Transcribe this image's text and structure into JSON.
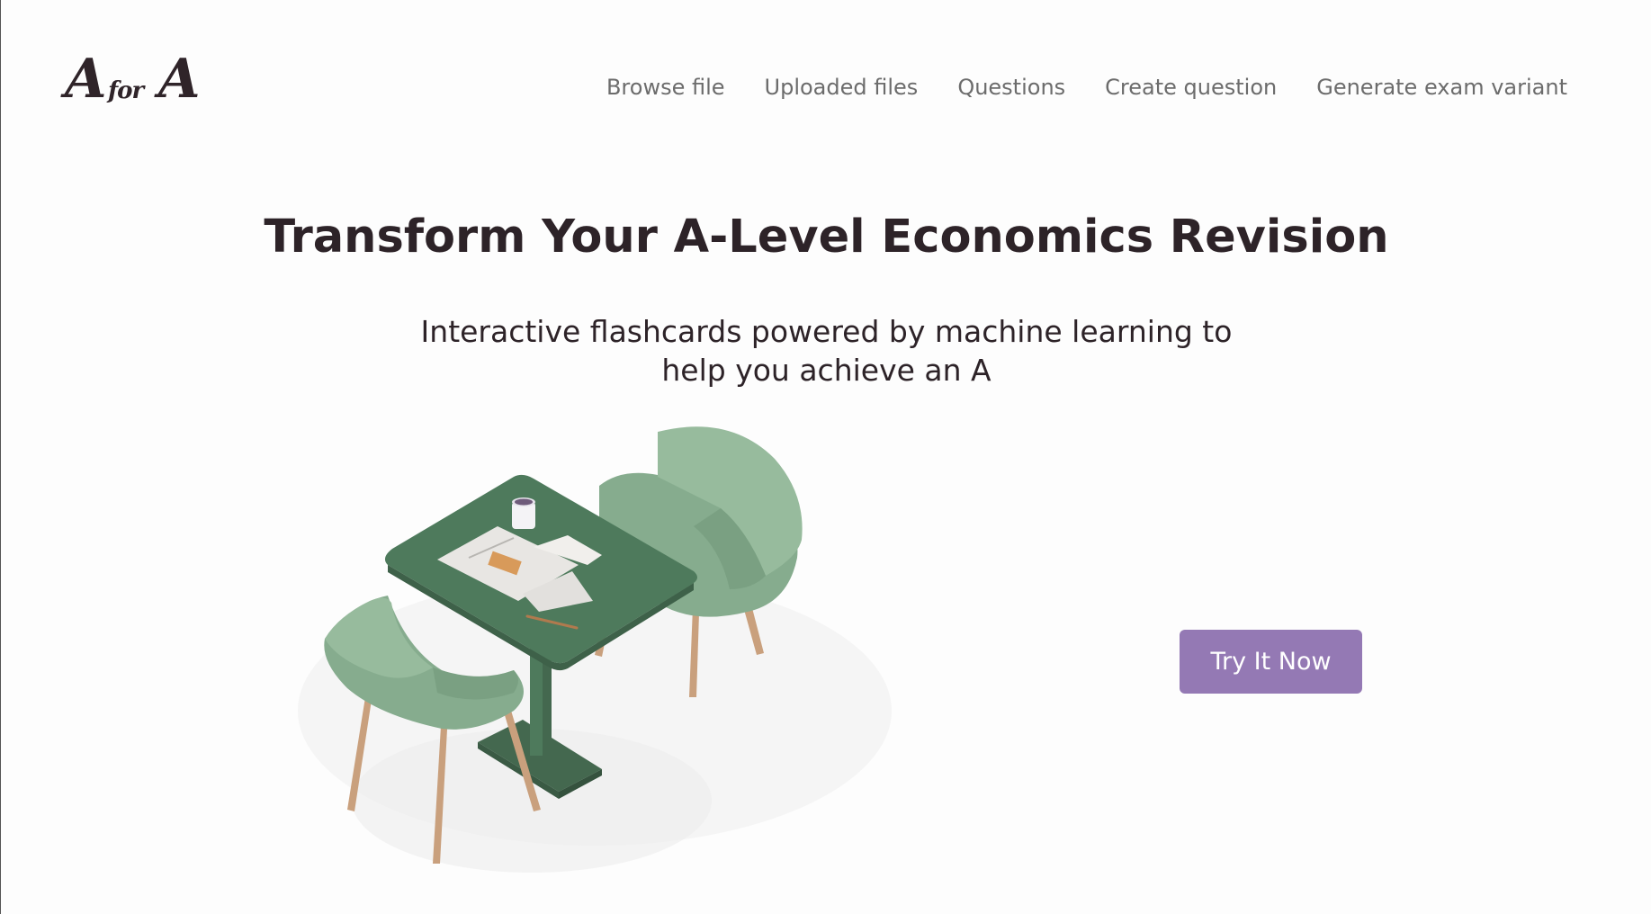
{
  "logo": {
    "letter_left": "A",
    "word_middle": "for",
    "letter_right": "A"
  },
  "nav": {
    "items": [
      {
        "label": "Browse file"
      },
      {
        "label": "Uploaded files"
      },
      {
        "label": "Questions"
      },
      {
        "label": "Create question"
      },
      {
        "label": "Generate exam variant"
      }
    ]
  },
  "hero": {
    "title": "Transform Your A-Level Economics Revision",
    "subtitle_line1": "Interactive flashcards powered by machine learning to",
    "subtitle_line2": "help you achieve an A",
    "cta_label": "Try It Now"
  },
  "colors": {
    "cta_background": "#9479b4",
    "title_text": "#2d2328",
    "nav_text": "#6c6c6c",
    "table_green": "#4e7a5c",
    "chair_green": "#86ac8e",
    "wood_legs": "#c9a07d"
  }
}
